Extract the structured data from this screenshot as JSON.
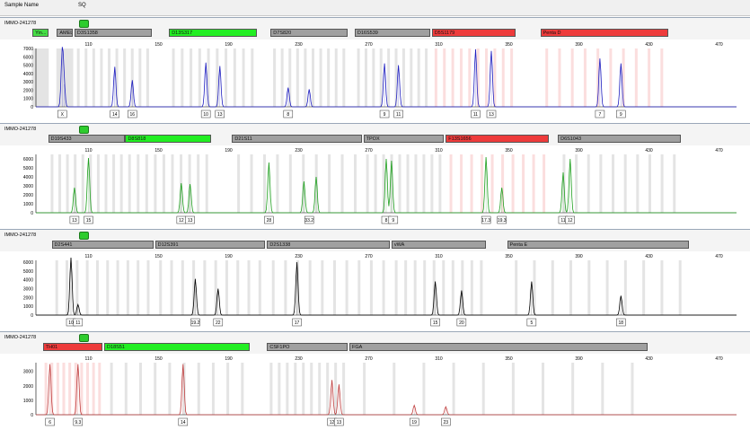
{
  "header": {
    "col_sample_name": "Sample Name",
    "col_sq": "SQ"
  },
  "x_ticks": [
    "110",
    "150",
    "190",
    "230",
    "270",
    "310",
    "350",
    "390",
    "430",
    "470"
  ],
  "locus_colors": {
    "gray": "#a0a0a0",
    "green": "#22ee22",
    "red": "#ee3b3b",
    "small_green": "#44dd44"
  },
  "trace_colors": {
    "blue": "#2020c0",
    "green": "#20a020",
    "black": "#000000",
    "red": "#c04040"
  },
  "chart_data": [
    {
      "type": "line",
      "sample": "IMMO-241278",
      "dye": "blue",
      "ylim": [
        0,
        7000
      ],
      "y_ticks": [
        "7000",
        "6000",
        "5000",
        "4000",
        "3000",
        "2000",
        "1000",
        "0"
      ],
      "loci": [
        {
          "name": "Yin...",
          "color": "small_green",
          "start": 78,
          "end": 87
        },
        {
          "name": "AMEL",
          "color": "gray",
          "start": 92,
          "end": 101
        },
        {
          "name": "D3S1358",
          "color": "gray",
          "start": 102,
          "end": 146
        },
        {
          "name": "D13S317",
          "color": "green",
          "start": 156,
          "end": 206
        },
        {
          "name": "D7S820",
          "color": "gray",
          "start": 214,
          "end": 258
        },
        {
          "name": "D16S539",
          "color": "gray",
          "start": 262,
          "end": 305
        },
        {
          "name": "D5S1179",
          "color": "red",
          "start": 306,
          "end": 354
        },
        {
          "name": "Penta D",
          "color": "red",
          "start": 368,
          "end": 441
        }
      ],
      "peaks": [
        {
          "x": 95,
          "h": 6400
        },
        {
          "x": 96,
          "h": 2700
        },
        {
          "x": 125,
          "h": 4800
        },
        {
          "x": 135,
          "h": 3200
        },
        {
          "x": 177,
          "h": 5300
        },
        {
          "x": 185,
          "h": 4900
        },
        {
          "x": 224,
          "h": 2300
        },
        {
          "x": 236,
          "h": 2100
        },
        {
          "x": 279,
          "h": 5200
        },
        {
          "x": 287,
          "h": 5000
        },
        {
          "x": 331,
          "h": 6900
        },
        {
          "x": 340,
          "h": 6700
        },
        {
          "x": 402,
          "h": 5800
        },
        {
          "x": 414,
          "h": 5200
        }
      ],
      "allele_labels": [
        {
          "x": 95,
          "label": "X"
        },
        {
          "x": 125,
          "label": "14"
        },
        {
          "x": 135,
          "label": "16"
        },
        {
          "x": 177,
          "label": "10"
        },
        {
          "x": 185,
          "label": "13"
        },
        {
          "x": 224,
          "label": "8"
        },
        {
          "x": 279,
          "label": "9"
        },
        {
          "x": 287,
          "label": "11"
        },
        {
          "x": 331,
          "label": "11"
        },
        {
          "x": 340,
          "label": "13"
        },
        {
          "x": 402,
          "label": "7"
        },
        {
          "x": 414,
          "label": "9"
        }
      ]
    },
    {
      "type": "line",
      "sample": "IMMO-241278",
      "dye": "green",
      "ylim": [
        0,
        6500
      ],
      "y_ticks": [
        "6000",
        "5000",
        "4000",
        "3000",
        "2000",
        "1000",
        "0"
      ],
      "loci": [
        {
          "name": "D19S433",
          "color": "gray",
          "start": 87,
          "end": 131
        },
        {
          "name": "D8S818",
          "color": "green",
          "start": 131,
          "end": 180
        },
        {
          "name": "D21S11",
          "color": "gray",
          "start": 192,
          "end": 266
        },
        {
          "name": "TPOX",
          "color": "gray",
          "start": 267,
          "end": 313
        },
        {
          "name": "F13S1656",
          "color": "red",
          "start": 314,
          "end": 373
        },
        {
          "name": "D6S1043",
          "color": "gray",
          "start": 378,
          "end": 448
        }
      ],
      "peaks": [
        {
          "x": 102,
          "h": 2800
        },
        {
          "x": 110,
          "h": 6100
        },
        {
          "x": 163,
          "h": 3300
        },
        {
          "x": 168,
          "h": 3200
        },
        {
          "x": 213,
          "h": 5600
        },
        {
          "x": 233,
          "h": 3500
        },
        {
          "x": 240,
          "h": 4000
        },
        {
          "x": 280,
          "h": 6000
        },
        {
          "x": 283,
          "h": 5800
        },
        {
          "x": 337,
          "h": 6200
        },
        {
          "x": 346,
          "h": 2800
        },
        {
          "x": 381,
          "h": 4500
        },
        {
          "x": 385,
          "h": 6000
        }
      ],
      "allele_labels": [
        {
          "x": 102,
          "label": "13"
        },
        {
          "x": 110,
          "label": "15"
        },
        {
          "x": 163,
          "label": "12"
        },
        {
          "x": 168,
          "label": "13"
        },
        {
          "x": 213,
          "label": "28"
        },
        {
          "x": 236,
          "label": "33.2"
        },
        {
          "x": 280,
          "label": "8"
        },
        {
          "x": 284,
          "label": "9"
        },
        {
          "x": 337,
          "label": "17.3"
        },
        {
          "x": 346,
          "label": "19.3"
        },
        {
          "x": 381,
          "label": "11"
        },
        {
          "x": 385,
          "label": "12"
        }
      ]
    },
    {
      "type": "line",
      "sample": "IMMO-241278",
      "dye": "black",
      "ylim": [
        0,
        6200
      ],
      "y_ticks": [
        "6000",
        "5000",
        "4000",
        "3000",
        "2000",
        "1000",
        "0"
      ],
      "loci": [
        {
          "name": "D2S441",
          "color": "gray",
          "start": 89,
          "end": 147
        },
        {
          "name": "D12S391",
          "color": "gray",
          "start": 148,
          "end": 211
        },
        {
          "name": "D2S1338",
          "color": "gray",
          "start": 212,
          "end": 282
        },
        {
          "name": "vWA",
          "color": "gray",
          "start": 283,
          "end": 337
        },
        {
          "name": "Penta E",
          "color": "gray",
          "start": 349,
          "end": 453
        }
      ],
      "peaks": [
        {
          "x": 100,
          "h": 6500
        },
        {
          "x": 104,
          "h": 1200
        },
        {
          "x": 171,
          "h": 4100
        },
        {
          "x": 184,
          "h": 3000
        },
        {
          "x": 229,
          "h": 6000
        },
        {
          "x": 308,
          "h": 3800
        },
        {
          "x": 323,
          "h": 2800
        },
        {
          "x": 363,
          "h": 3800
        },
        {
          "x": 414,
          "h": 2200
        }
      ],
      "allele_labels": [
        {
          "x": 100,
          "label": "10"
        },
        {
          "x": 104,
          "label": "11"
        },
        {
          "x": 171,
          "label": "19.2"
        },
        {
          "x": 184,
          "label": "22"
        },
        {
          "x": 229,
          "label": "17"
        },
        {
          "x": 308,
          "label": "15"
        },
        {
          "x": 323,
          "label": "20"
        },
        {
          "x": 363,
          "label": "5"
        },
        {
          "x": 414,
          "label": "18"
        }
      ]
    },
    {
      "type": "line",
      "sample": "IMMO-241278",
      "dye": "red",
      "ylim": [
        0,
        3600
      ],
      "y_ticks": [
        "3000",
        "2000",
        "1000",
        "0"
      ],
      "loci": [
        {
          "name": "TH01",
          "color": "red",
          "start": 84,
          "end": 118
        },
        {
          "name": "D18S51",
          "color": "green",
          "start": 119,
          "end": 202
        },
        {
          "name": "CSF1PO",
          "color": "gray",
          "start": 212,
          "end": 258
        },
        {
          "name": "FGA",
          "color": "gray",
          "start": 259,
          "end": 429
        }
      ],
      "peaks": [
        {
          "x": 88,
          "h": 3500
        },
        {
          "x": 104,
          "h": 3500
        },
        {
          "x": 164,
          "h": 3500
        },
        {
          "x": 249,
          "h": 2400
        },
        {
          "x": 253,
          "h": 2100
        },
        {
          "x": 296,
          "h": 650
        },
        {
          "x": 314,
          "h": 550
        }
      ],
      "allele_labels": [
        {
          "x": 88,
          "label": "6"
        },
        {
          "x": 104,
          "label": "9.3"
        },
        {
          "x": 164,
          "label": "14"
        },
        {
          "x": 249,
          "label": "12"
        },
        {
          "x": 253,
          "label": "13"
        },
        {
          "x": 296,
          "label": "19"
        },
        {
          "x": 314,
          "label": "23"
        }
      ]
    }
  ]
}
